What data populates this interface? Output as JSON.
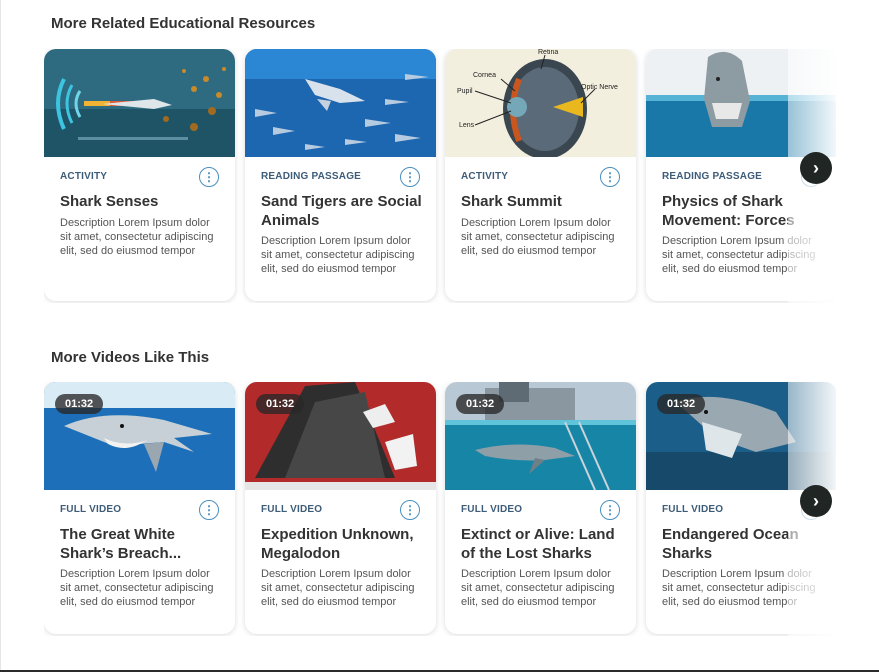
{
  "sections": [
    {
      "title": "More Related Educational Resources",
      "next_icon": "chevron-right-icon",
      "cards": [
        {
          "type": "ACTIVITY",
          "title": "Shark Senses",
          "description": "Description Lorem Ipsum dolor sit amet, consectetur adipiscing elit, sed do eiusmod tempor"
        },
        {
          "type": "READING PASSAGE",
          "title": "Sand Tigers are Social Animals",
          "description": "Description Lorem Ipsum dolor sit amet, consectetur adipiscing elit, sed do eiusmod tempor"
        },
        {
          "type": "ACTIVITY",
          "title": "Shark Summit",
          "description": "Description Lorem Ipsum dolor sit amet, consectetur adipiscing elit, sed do eiusmod tempor",
          "diagram_labels": [
            "Retina",
            "Cornea",
            "Pupil",
            "Optic Nerve",
            "Lens"
          ]
        },
        {
          "type": "READING PASSAGE",
          "title": "Physics of Shark Movement: Forces",
          "description": "Description Lorem Ipsum dolor sit amet, consectetur adipiscing elit, sed do eiusmod tempor"
        }
      ]
    },
    {
      "title": "More Videos Like This",
      "next_icon": "chevron-right-icon",
      "cards": [
        {
          "duration": "01:32",
          "type": "FULL VIDEO",
          "title": "The Great White Shark’s Breach...",
          "description": "Description Lorem Ipsum dolor sit amet, consectetur adipiscing elit, sed do eiusmod tempor"
        },
        {
          "duration": "01:32",
          "type": "FULL VIDEO",
          "title": "Expedition Unknown, Megalodon",
          "description": "Description Lorem Ipsum dolor sit amet, consectetur adipiscing elit, sed do eiusmod tempor"
        },
        {
          "duration": "01:32",
          "type": "FULL VIDEO",
          "title": "Extinct or Alive: Land of the Lost Sharks",
          "description": "Description Lorem Ipsum dolor sit amet, consectetur adipiscing elit, sed do eiusmod tempor"
        },
        {
          "duration": "01:32",
          "type": "FULL VIDEO",
          "title": "Endangered Ocean Sharks",
          "description": "Description Lorem Ipsum dolor sit amet, consectetur adipiscing elit, sed do eiusmod tempor"
        }
      ]
    }
  ],
  "colors": {
    "type_label": "#3d5c78",
    "more_button": "#4a8fbf",
    "next_button": "#1f2624"
  }
}
